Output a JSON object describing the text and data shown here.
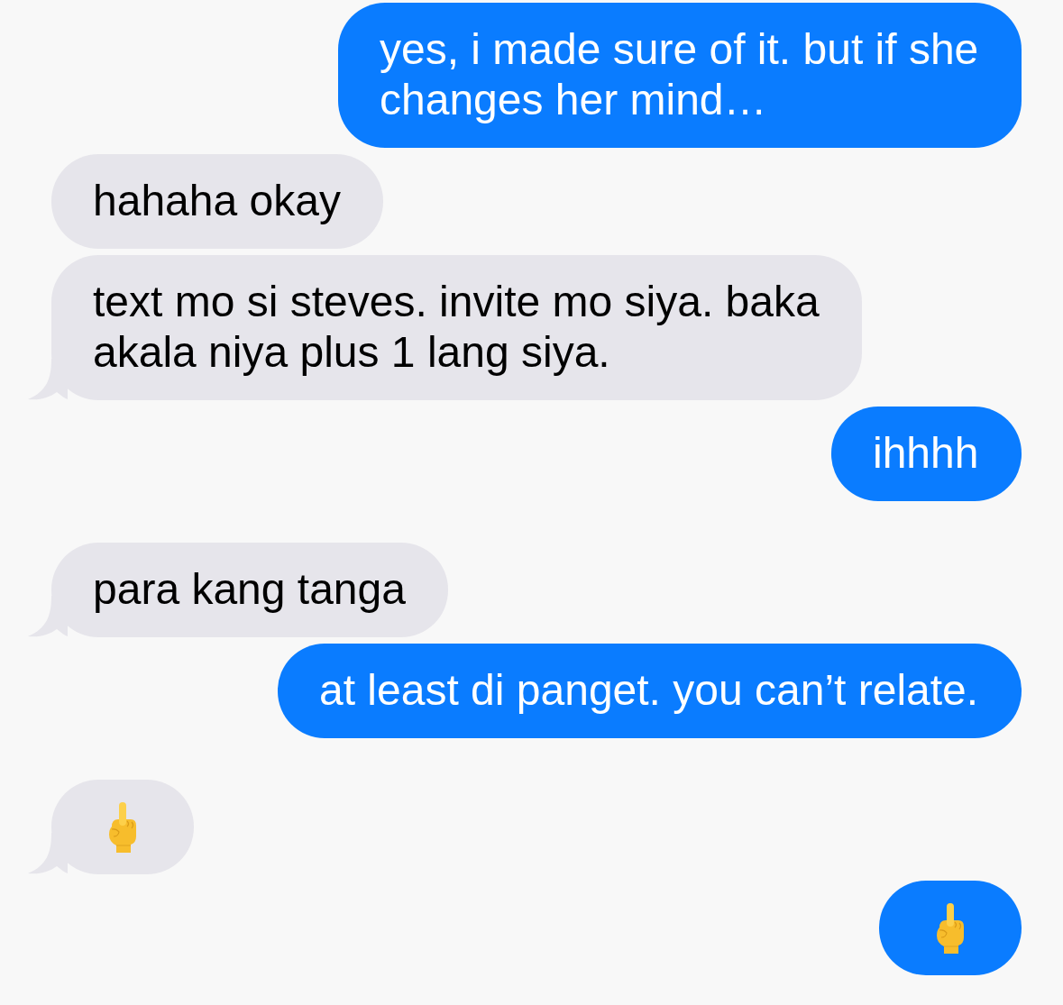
{
  "messages": [
    {
      "sent": true,
      "kind": "text",
      "text": "yes, i made sure of it. but if she changes her mind…",
      "tail": false
    },
    {
      "sent": false,
      "kind": "text",
      "text": "hahaha okay",
      "tail": false
    },
    {
      "sent": false,
      "kind": "text",
      "text": "text mo si steves. invite mo siya. baka akala niya plus 1 lang siya.",
      "tail": true
    },
    {
      "sent": true,
      "kind": "text",
      "text": "ihhhh",
      "tail": false
    },
    {
      "sent": false,
      "kind": "text",
      "text": "para kang tanga",
      "tail": true
    },
    {
      "sent": true,
      "kind": "text",
      "text": "at least di panget. you can’t relate.",
      "tail": false
    },
    {
      "sent": false,
      "kind": "emoji",
      "tail": true
    },
    {
      "sent": true,
      "kind": "emoji",
      "tail": false
    }
  ]
}
